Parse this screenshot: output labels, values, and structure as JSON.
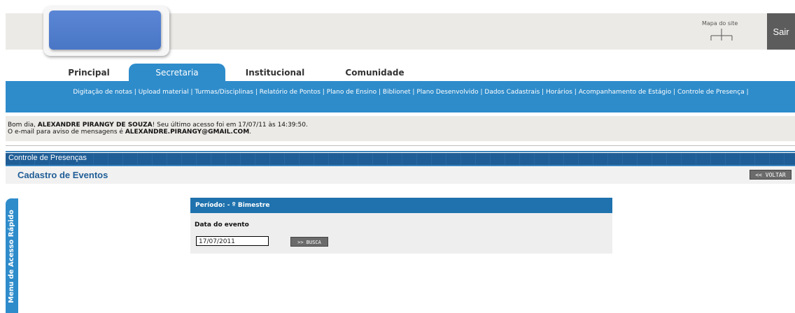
{
  "header": {
    "sitemap_label": "Mapa do site",
    "logout_label": "Sair"
  },
  "tabs": [
    {
      "label": "Principal",
      "active": false
    },
    {
      "label": "Secretaria",
      "active": true
    },
    {
      "label": "Institucional",
      "active": false
    },
    {
      "label": "Comunidade",
      "active": false
    }
  ],
  "subnav": {
    "items": [
      "Digitação de notas",
      "Upload material",
      "Turmas/Disciplinas",
      "Relatório de Pontos",
      "Plano de Ensino",
      "Biblionet",
      "Plano Desenvolvido",
      "Dados Cadastrais",
      "Horários",
      "Acompanhamento de Estágio",
      "Controle de Presença"
    ],
    "separator": " | "
  },
  "welcome": {
    "greeting_prefix": "Bom dia, ",
    "user_name": "ALEXANDRE PIRANGY DE SOUZA",
    "last_access": "! Seu último acesso foi em 17/07/11 às 14:39:50.",
    "email_prefix": "O e-mail para aviso de mensagens é ",
    "email": "ALEXANDRE.PIRANGY@GMAIL.COM",
    "email_suffix": "."
  },
  "section": {
    "title": "Controle de Presenças",
    "page_title": "Cadastro de Eventos",
    "back_button": "<< VOLTAR"
  },
  "side_menu": {
    "label": "Menu de Acesso Rápido"
  },
  "form": {
    "period_label": "Período: - º Bimestre",
    "date_label": "Data do evento",
    "date_value": "17/07/2011",
    "search_button": ">> BUSCA"
  },
  "colors": {
    "primary_blue": "#2e8ccb",
    "dark_blue": "#1f5d96",
    "header_bg": "#eceae6",
    "button_gray": "#6b6b6b"
  }
}
